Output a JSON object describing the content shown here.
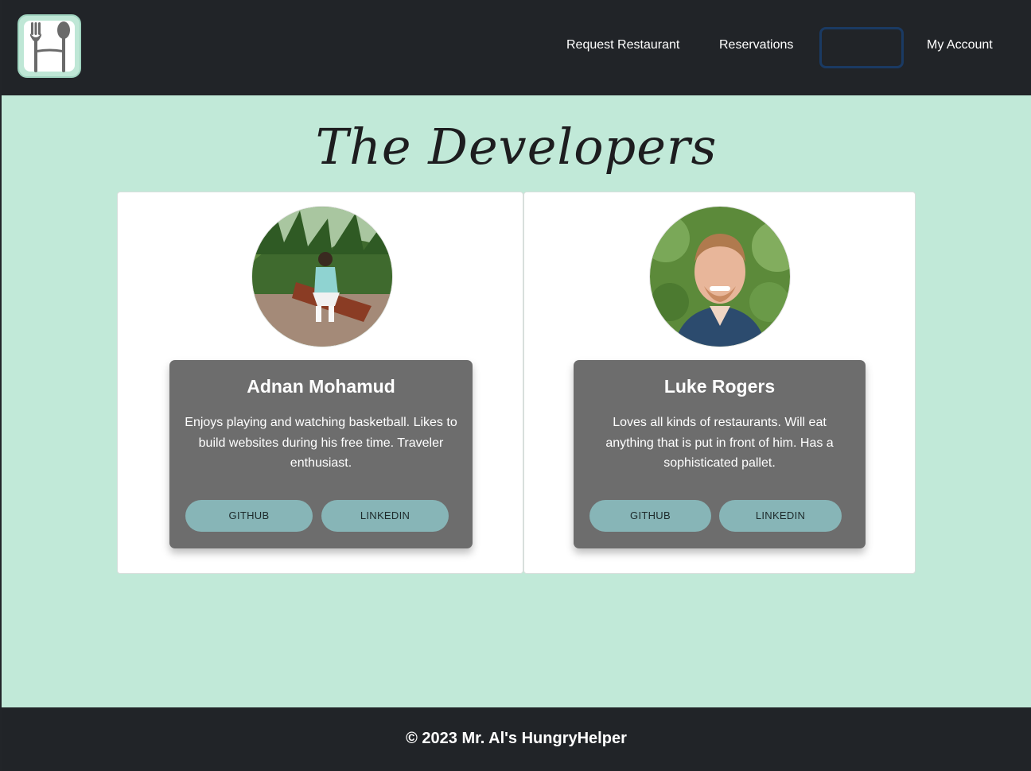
{
  "nav": {
    "links": [
      "Request Restaurant",
      "Reservations",
      "My Account"
    ],
    "logo_icon": "fork-and-spoon-logo"
  },
  "page": {
    "title": "The Developers"
  },
  "developers": [
    {
      "name": "Adnan Mohamud",
      "bio": "Enjoys playing and watching basketball. Likes to build websites during his free time. Traveler enthusiast.",
      "github_label": "GITHUB",
      "linkedin_label": "LINKEDIN"
    },
    {
      "name": "Luke Rogers",
      "bio": "Loves all kinds of restaurants. Will eat anything that is put in front of him. Has a sophisticated pallet.",
      "github_label": "GITHUB",
      "linkedin_label": "LINKEDIN"
    }
  ],
  "footer": {
    "text": "© 2023 Mr. Al's HungryHelper"
  },
  "colors": {
    "navbar": "#212428",
    "background": "#c1e9d8",
    "info_card": "#6d6d6d",
    "button": "#87b5b7",
    "nav_outline": "#1a3a63"
  }
}
